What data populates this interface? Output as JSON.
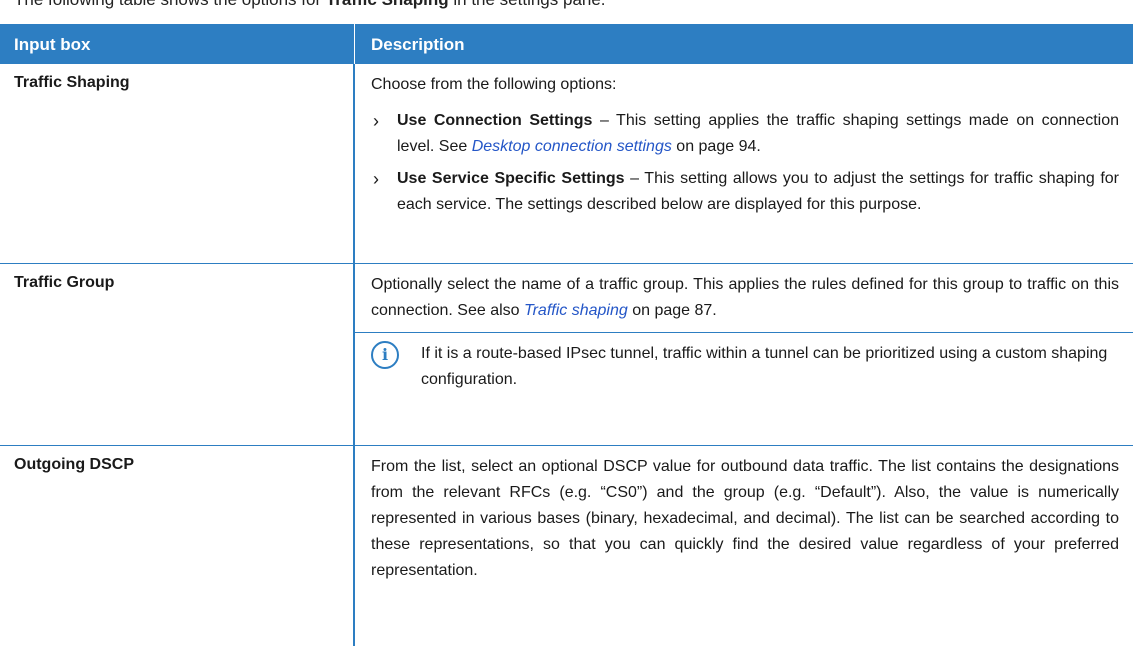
{
  "caption": {
    "pre": "The following table shows the options for ",
    "bold": "Traffic Shaping",
    "post": " in the settings pane."
  },
  "table": {
    "headers": [
      "Input box",
      "Description"
    ],
    "traffic_shaping": {
      "label": "Traffic Shaping",
      "intro": "Choose from the following options:",
      "b1_title": "Use Connection Settings",
      "b1_text": " – This setting applies the traffic shaping settings made on connection level. See ",
      "b1_link": "Desktop connection settings",
      "b1_tail": " on page 94.",
      "b2_title": "Use Service Specific Settings",
      "b2_text": " – This setting allows you to adjust the settings for traffic shaping for each service. The settings described below are displayed for this purpose."
    },
    "traffic_group": {
      "label": "Traffic Group",
      "text": "Optionally select the name of a traffic group. This applies the rules defined for this group to traffic on this connection. See also ",
      "link": "Traffic shaping",
      "tail": " on page 87.",
      "note": "If it is a route-based IPsec tunnel, traffic within a tunnel can be prioritized using a custom shaping configuration."
    },
    "outgoing_dscp": {
      "label": "Outgoing DSCP",
      "text": "From the list, select an optional DSCP value for outbound data traffic. The list contains the designations from the relevant RFCs (e.g. “CS0”) and the group (e.g. “Default”). Also, the value is numerically represented in various bases (binary, hexadecimal, and decimal). The list can be searched according to these representations, so that you can quickly find the desired value regardless of your preferred representation."
    }
  },
  "colors": {
    "header_bg": "#2d7ec2",
    "link": "#2456c7"
  },
  "icons": {
    "note": "info-icon",
    "bullet": "chevron-right-icon"
  }
}
